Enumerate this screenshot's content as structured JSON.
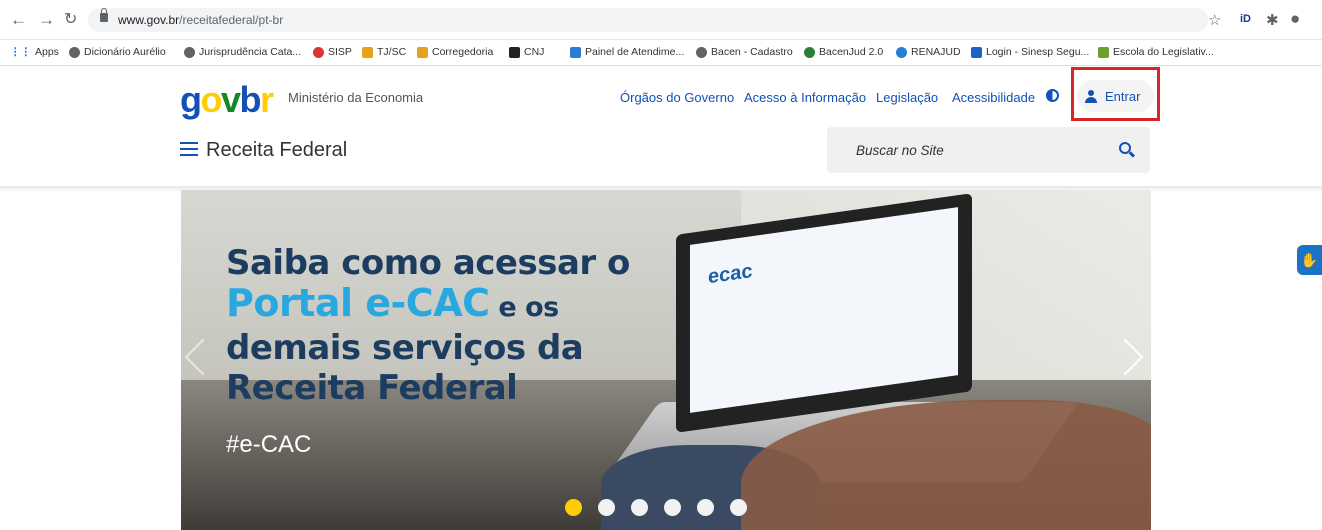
{
  "browser": {
    "url_domain": "www.gov.br",
    "url_path": "/receitafederal/pt-br",
    "bookmarks": [
      "Apps",
      "Dicionário Aurélio",
      "Jurisprudência Cata...",
      "SISP",
      "TJ/SC",
      "Corregedoria",
      "CNJ",
      "Painel de Atendime...",
      "Bacen - Cadastro",
      "BacenJud 2.0",
      "RENAJUD",
      "Login - Sinesp Segu...",
      "Escola do Legislativ..."
    ]
  },
  "header": {
    "logo": {
      "g": "g",
      "o": "o",
      "v": "v",
      "b": "b",
      "r": "r"
    },
    "ministry": "Ministério da Economia",
    "nav": [
      "Órgãos do Governo",
      "Acesso à Informação",
      "Legislação",
      "Acessibilidade"
    ],
    "login_label": "Entrar",
    "site_title": "Receita Federal",
    "search_placeholder": "Buscar no Site"
  },
  "banner": {
    "line1": "Saiba como acessar o",
    "line2_accent": "Portal e-CAC",
    "line2_rest": " e os",
    "line3": "demais serviços da",
    "line4": "Receita Federal",
    "hashtag": "#e-CAC",
    "screen_logo": "ecac",
    "slide_count": 6,
    "active_slide": 1
  },
  "colors": {
    "brand_blue": "#1351b4",
    "accent_yellow": "#ffcd07",
    "accent_green": "#168821",
    "highlight_red": "#d7262b"
  }
}
